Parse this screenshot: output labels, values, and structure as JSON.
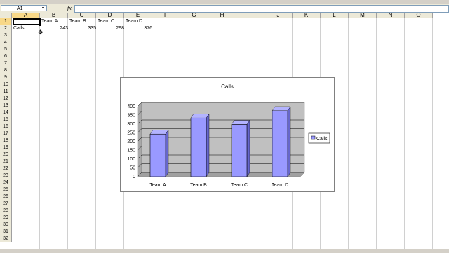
{
  "formula_bar": {
    "name_box": "A1",
    "fx_label": "fx",
    "formula": ""
  },
  "columns": [
    "A",
    "B",
    "C",
    "D",
    "E",
    "F",
    "G",
    "H",
    "I",
    "J",
    "K",
    "L",
    "M",
    "N",
    "O"
  ],
  "rows": [
    "1",
    "2",
    "3",
    "4",
    "5",
    "6",
    "7",
    "8",
    "9",
    "10",
    "11",
    "12",
    "13",
    "14",
    "15",
    "16",
    "17",
    "18",
    "19",
    "20",
    "21",
    "22",
    "23",
    "24",
    "25",
    "26",
    "27",
    "28",
    "29",
    "30",
    "31",
    "32"
  ],
  "sheet": {
    "row1": [
      "",
      "Team A",
      "Team B",
      "Team C",
      "Team D"
    ],
    "row2": [
      "Calls",
      "243",
      "335",
      "298",
      "376"
    ]
  },
  "colors": {
    "bar_fill": "#9999ff",
    "plot_bg": "#c0c0c0",
    "active_header": "#f8d888"
  },
  "chart_data": {
    "type": "bar",
    "title": "Calls",
    "categories": [
      "Team A",
      "Team B",
      "Team C",
      "Team D"
    ],
    "series": [
      {
        "name": "Calls",
        "values": [
          243,
          335,
          298,
          376
        ]
      }
    ],
    "yticks": [
      "0",
      "50",
      "100",
      "150",
      "200",
      "250",
      "300",
      "350",
      "400"
    ],
    "ylim": [
      0,
      400
    ],
    "grid": true,
    "legend": "right"
  }
}
